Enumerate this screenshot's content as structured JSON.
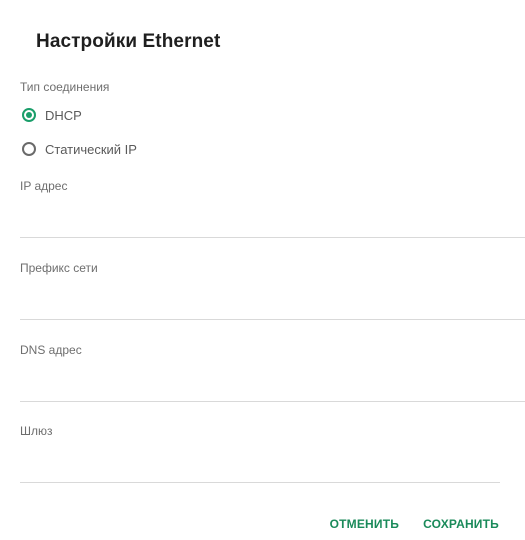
{
  "dialog": {
    "title": "Настройки Ethernet",
    "connection_type_label": "Тип соединения",
    "options": [
      {
        "label": "DHCP",
        "selected": true
      },
      {
        "label": "Статический IP",
        "selected": false
      }
    ],
    "fields": [
      {
        "label": "IP адрес",
        "value": ""
      },
      {
        "label": "Префикс сети",
        "value": ""
      },
      {
        "label": "DNS адрес",
        "value": ""
      },
      {
        "label": "Шлюз",
        "value": ""
      }
    ],
    "buttons": {
      "cancel": "ОТМЕНИТЬ",
      "save": "СОХРАНИТЬ"
    },
    "accent_color": "#1a9e6a"
  }
}
